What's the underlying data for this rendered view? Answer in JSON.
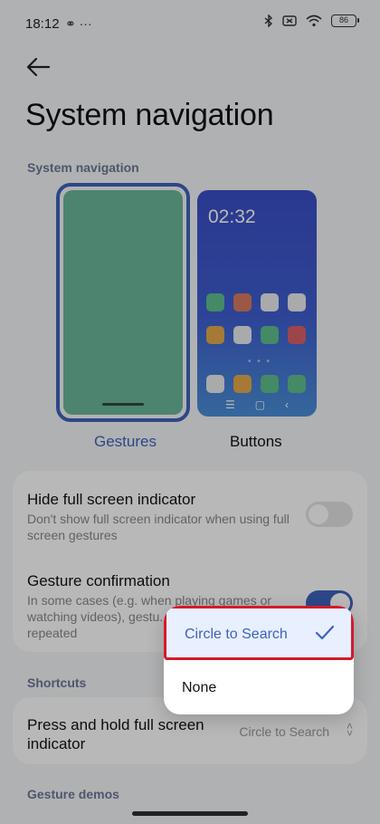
{
  "status": {
    "time": "18:12",
    "left_icons": "⚭ ···",
    "battery": "86"
  },
  "header": {
    "title": "System navigation"
  },
  "sections": {
    "navigation": "System navigation",
    "shortcuts": "Shortcuts",
    "demos": "Gesture demos"
  },
  "nav_options": {
    "gestures": {
      "label": "Gestures",
      "selected": true
    },
    "buttons": {
      "label": "Buttons",
      "clock": "02:32"
    }
  },
  "settings": {
    "hide_indicator": {
      "title": "Hide full screen indicator",
      "description": "Don't show full screen indicator when using full screen gestures",
      "enabled": false
    },
    "gesture_confirmation": {
      "title": "Gesture confirmation",
      "description": "In some cases (e.g. when playing games or watching videos), gestu... after they are repeated",
      "enabled": true
    },
    "press_hold": {
      "title": "Press and hold full screen indicator",
      "value": "Circle to Search"
    }
  },
  "popup": {
    "options": [
      {
        "label": "Circle to Search",
        "selected": true
      },
      {
        "label": "None",
        "selected": false
      }
    ]
  },
  "colors": {
    "accent": "#3f63bd",
    "highlight_box": "#d7192a",
    "gesture_preview": "#6ab89a"
  }
}
